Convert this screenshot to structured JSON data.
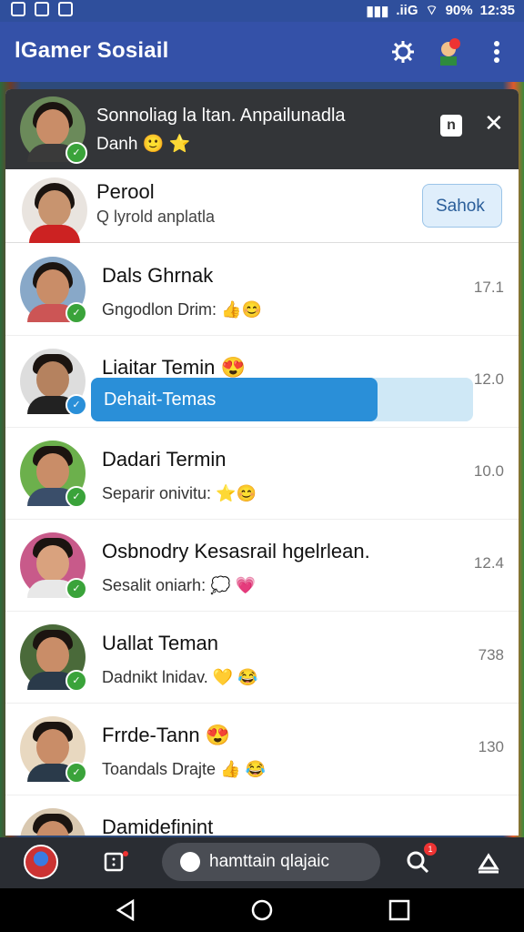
{
  "status_bar": {
    "battery": "90%",
    "time": "12:35",
    "network": ".iiG"
  },
  "app_bar": {
    "title": "lGamer Sosiail",
    "icons": [
      "settings-gear-icon",
      "avatar-badge-icon",
      "more-vert-icon"
    ]
  },
  "notification": {
    "title": "Sonnoliag la ltan. Anpailunadla",
    "subtitle": "Danh",
    "emoji": "🙂 ⭐",
    "copy_label": "n"
  },
  "profile": {
    "name": "Perool",
    "subtitle": "Q lyrold anplatla",
    "action_label": "Sahok"
  },
  "rows": [
    {
      "name": "Dals  Ghrnak",
      "message": "Gngodlon Drim: 👍😊",
      "time": "17.1",
      "badge": "✓"
    },
    {
      "name": "Liaitar Temin",
      "emoji": "😍",
      "time": "12.0",
      "badge": "✓",
      "progress_label": "Dehait-Temas",
      "progress": 0.75
    },
    {
      "name": "Dadari Termin",
      "message": "Separir onivitu: ⭐😊",
      "time": "10.0",
      "badge": "✓"
    },
    {
      "name": "Osbnodry Kesasrail hgelrlean.",
      "message": "Sesalit oniarh: 💭 💗",
      "time": "12.4",
      "badge": "✓"
    },
    {
      "name": "Uallat Teman",
      "message": "Dadnikt lnidav. 💛 😂",
      "time": "738",
      "badge": "✓"
    },
    {
      "name": "Frrde-Tann",
      "emoji": "😍",
      "message": "Toandals Drajte 👍 😂",
      "time": "130",
      "badge": "✓"
    },
    {
      "name": "Damidefinint",
      "message": "",
      "time": "",
      "badge": ""
    }
  ],
  "bottom_bar": {
    "search_placeholder": "hamttain qlajaic",
    "notif_count": "1",
    "fab_count": "1"
  },
  "colors": {
    "app_bar": "#3451a8",
    "accent": "#2a8fd8",
    "online": "#3aa33a"
  }
}
